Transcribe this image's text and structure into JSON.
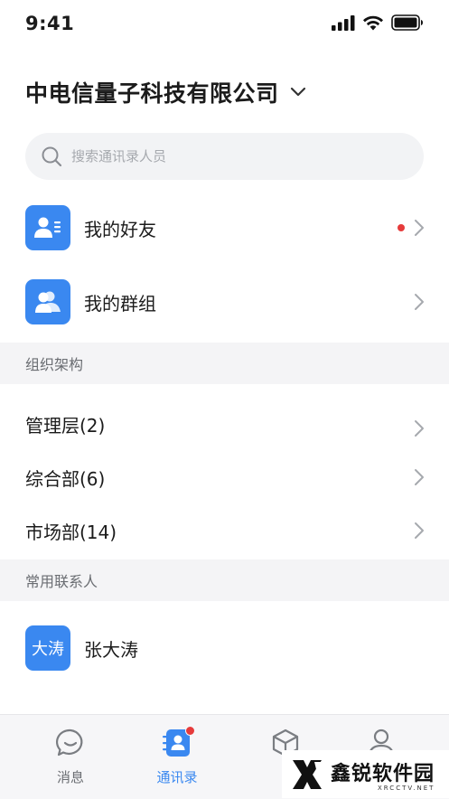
{
  "status_bar": {
    "time": "9:41"
  },
  "header": {
    "company_name": "中电信量子科技有限公司"
  },
  "search": {
    "placeholder": "搜索通讯录人员"
  },
  "quick_menu": [
    {
      "label": "我的好友",
      "icon": "friends-icon",
      "has_badge": true
    },
    {
      "label": "我的群组",
      "icon": "groups-icon",
      "has_badge": false
    }
  ],
  "org_section": {
    "title": "组织架构",
    "departments": [
      {
        "label": "管理层(2)"
      },
      {
        "label": "综合部(6)"
      },
      {
        "label": "市场部(14)"
      }
    ]
  },
  "frequent_section": {
    "title": "常用联系人",
    "contacts": [
      {
        "avatar_text": "大涛",
        "name": "张大涛"
      }
    ]
  },
  "tab_bar": {
    "tabs": [
      {
        "label": "消息",
        "icon": "chat-bubble-icon",
        "active": false
      },
      {
        "label": "通讯录",
        "icon": "contacts-book-icon",
        "active": true,
        "has_badge": true
      },
      {
        "label": "",
        "icon": "cube-icon",
        "active": false
      },
      {
        "label": "",
        "icon": "user-profile-icon",
        "active": false
      }
    ]
  },
  "watermark": {
    "main": "鑫锐软件园",
    "sub": "XRCCTV.NET"
  },
  "colors": {
    "accent": "#3a88f0",
    "badge": "#e63b3b",
    "section_bg": "#f4f4f6"
  }
}
